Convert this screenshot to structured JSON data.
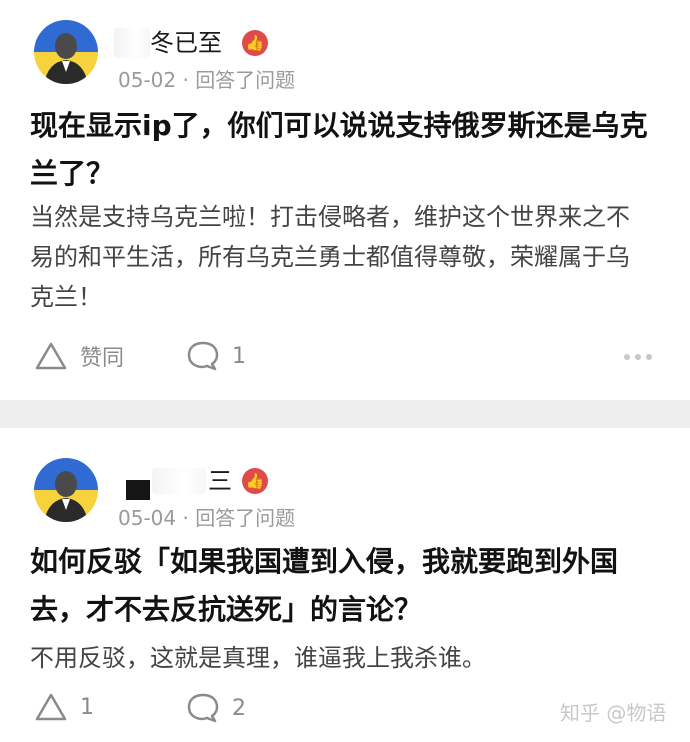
{
  "answers": [
    {
      "username_visible": "冬已至",
      "badge_icon": "thumb-up-icon",
      "meta": "05-02 · 回答了问题",
      "question": "现在显示ip了，你们可以说说支持俄罗斯还是乌克兰了？",
      "answer": "当然是支持乌克兰啦！打击侵略者，维护这个世界来之不易的和平生活，所有乌克兰勇士都值得尊敬，荣耀属于乌克兰！",
      "vote_label": "赞同",
      "comment_count": "1"
    },
    {
      "username_visible": "三",
      "badge_icon": "thumb-up-icon",
      "meta": "05-04 · 回答了问题",
      "question": "如何反驳「如果我国遭到入侵，我就要跑到外国去，才不去反抗送死」的言论？",
      "answer": "不用反驳，这就是真理，谁逼我上我杀谁。",
      "vote_count": "1",
      "comment_count": "2"
    }
  ],
  "watermark": "知乎 @物语",
  "colors": {
    "flag_blue": "#2f6bd2",
    "flag_yellow": "#f6d23c",
    "badge_red": "#e04a4a",
    "divider": "#ededed"
  }
}
